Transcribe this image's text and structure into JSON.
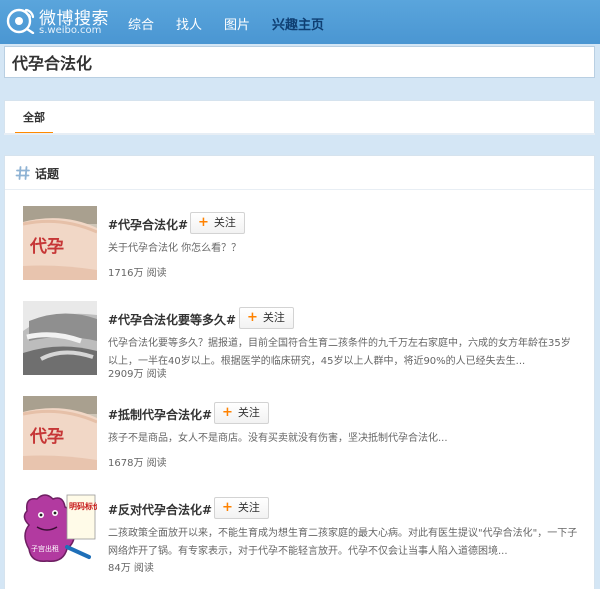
{
  "header": {
    "logo_title": "微博搜索",
    "logo_url": "s.weibo.com",
    "nav": [
      {
        "label": "综合"
      },
      {
        "label": "找人"
      },
      {
        "label": "图片"
      },
      {
        "label": "兴趣主页"
      }
    ],
    "active_nav": "兴趣主页"
  },
  "search": {
    "value": "代孕合法化"
  },
  "tabs": [
    {
      "label": "全部"
    }
  ],
  "section": {
    "title": "话题"
  },
  "topics": [
    {
      "title": "#代孕合法化#",
      "follow_label": "关注",
      "desc": "关于代孕合法化 你怎么看？？",
      "count": "1716万 阅读"
    },
    {
      "title": "#代孕合法化要等多久#",
      "follow_label": "关注",
      "desc": "代孕合法化要等多久？据报道，目前全国符合生育二孩条件的九千万左右家庭中，六成的女方年龄在35岁以上，一半在40岁以上。根据医学的临床研究，45岁以上人群中，将近90%的人已经失去生...",
      "count": "2909万 阅读"
    },
    {
      "title": "#抵制代孕合法化#",
      "follow_label": "关注",
      "desc": "孩子不是商品，女人不是商店。没有买卖就没有伤害，坚决抵制代孕合法化...",
      "count": "1678万 阅读"
    },
    {
      "title": "#反对代孕合法化#",
      "follow_label": "关注",
      "desc": "二孩政策全面放开以来，不能生育成为想生育二孩家庭的最大心病。对此有医生提议\"代孕合法化\"，一下子网络炸开了锅。有专家表示，对于代孕不能轻言放开。代孕不仅会让当事人陷入道德困境...",
      "count": "84万 阅读"
    }
  ],
  "thumb_text": {
    "belly_sign": "代孕",
    "poster_sign": "明码标价",
    "poster_tag": "子宫出租"
  },
  "colors": {
    "topbar": "#4a96d2",
    "page_bg": "#d4e6f5",
    "accent_orange": "#ff8200",
    "active_nav": "#0e3e72"
  },
  "icons": [
    "weibo-logo-icon",
    "hash-icon",
    "plus-icon"
  ]
}
